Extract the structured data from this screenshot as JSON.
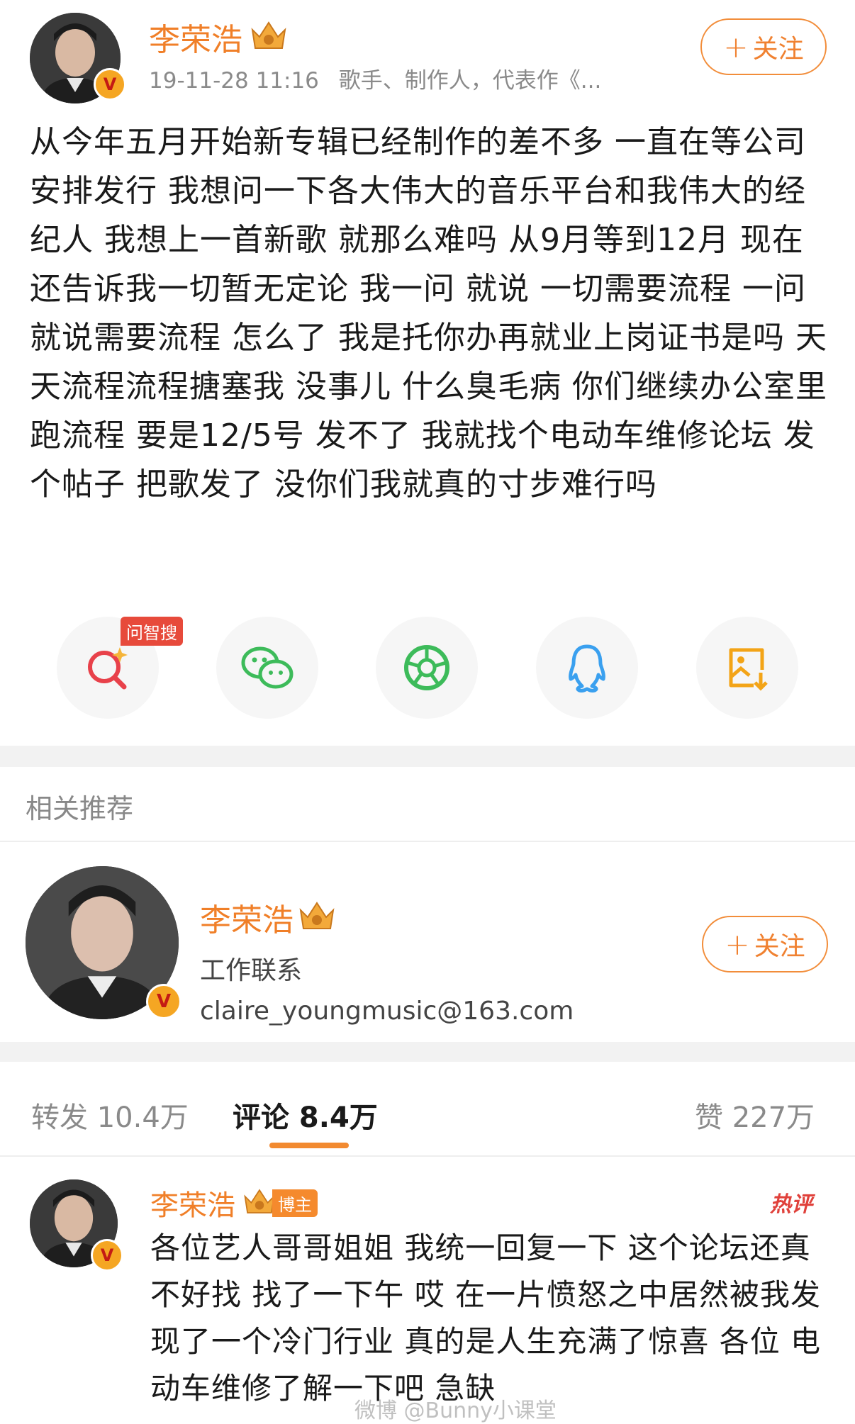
{
  "post": {
    "author": "李荣浩",
    "timestamp": "19-11-28 11:16",
    "bio": "歌手、制作人，代表作《...",
    "follow_label": "关注",
    "follow_plus": "+",
    "text": "从今年五月开始新专辑已经制作的差不多 一直在等公司安排发行 我想问一下各大伟大的音乐平台和我伟大的经纪人 我想上一首新歌 就那么难吗 从9月等到12月  现在还告诉我一切暂无定论 我一问 就说 一切需要流程 一问就说需要流程 怎么了 我是托你办再就业上岗证书是吗 天天流程流程搪塞我  没事儿 什么臭毛病 你们继续办公室里跑流程 要是12/5号 发不了 我就找个电动车维修论坛 发个帖子 把歌发了 没你们我就真的寸步难行吗"
  },
  "share": {
    "sticker": "问智搜",
    "items": [
      {
        "icon": "search-spark-icon",
        "color": "#e8414a"
      },
      {
        "icon": "wechat-icon",
        "color": "#3dbb5a"
      },
      {
        "icon": "moments-icon",
        "color": "#3dbb5a"
      },
      {
        "icon": "qq-icon",
        "color": "#3aa0ef"
      },
      {
        "icon": "save-image-icon",
        "color": "#f3a417"
      }
    ]
  },
  "related": {
    "title": "相关推荐",
    "name": "李荣浩",
    "line1": "工作联系",
    "line2": "claire_youngmusic@163.com",
    "follow_label": "关注",
    "follow_plus": "+"
  },
  "tabs": {
    "repost": "转发 10.4万",
    "comments": "评论 8.4万",
    "likes": "赞 227万"
  },
  "comment": {
    "author": "李荣浩",
    "badge": "博主",
    "hot": "热评",
    "text": "各位艺人哥哥姐姐 我统一回复一下 这个论坛还真不好找 找了一下午 哎 在一片愤怒之中居然被我发现了一个冷门行业  真的是人生充满了惊喜 各位 电动车维修了解一下吧 急缺"
  },
  "watermark": "微博 @Bunny小课堂",
  "colors": {
    "accent": "#f07f28",
    "divider": "#f2f2f2"
  }
}
